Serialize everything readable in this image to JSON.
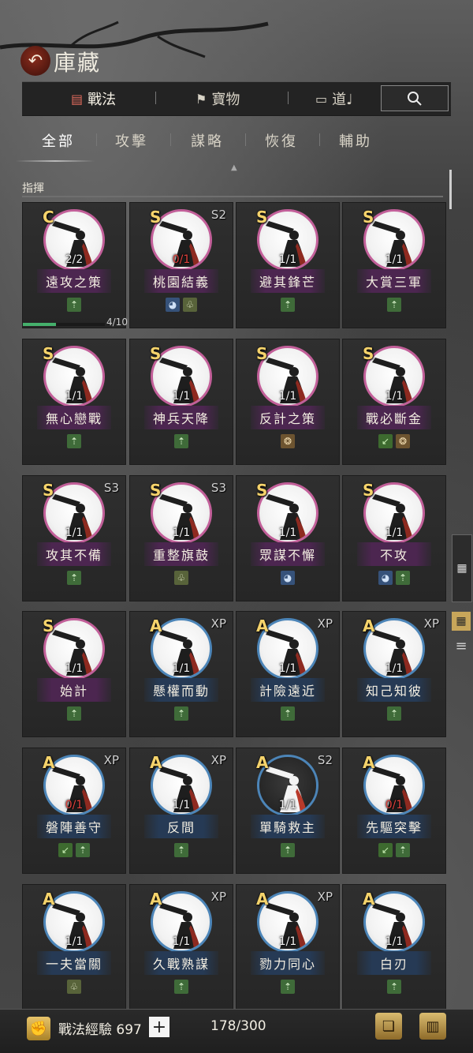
{
  "header": {
    "title": "庫藏",
    "back_icon": "arrow-left-icon"
  },
  "main_tabs": [
    {
      "label": "戰法",
      "icon": "scroll-icon",
      "active": true
    },
    {
      "label": "寶物",
      "icon": "flag-icon",
      "active": false
    },
    {
      "label": "道♩",
      "icon": "book-icon",
      "active": false
    }
  ],
  "search": {
    "icon": "search-icon"
  },
  "sub_tabs": [
    {
      "label": "全部",
      "active": true
    },
    {
      "label": "攻擊",
      "active": false
    },
    {
      "label": "謀略",
      "active": false
    },
    {
      "label": "恢復",
      "active": false
    },
    {
      "label": "輔助",
      "active": false
    }
  ],
  "section": {
    "title": "指揮"
  },
  "cards": [
    {
      "grade": "C",
      "badge": "",
      "count": "2/2",
      "count_red": false,
      "name": "遠攻之策",
      "ring": "pink",
      "tags": [
        "green"
      ],
      "progress": "4/10",
      "progress_value": 0.4
    },
    {
      "grade": "S",
      "badge": "S2",
      "count": "0/1",
      "count_red": true,
      "name": "桃園結義",
      "ring": "pink",
      "tags": [
        "blue",
        "olive"
      ],
      "dark": false
    },
    {
      "grade": "S",
      "badge": "",
      "count": "1/1",
      "count_red": false,
      "name": "避其鋒芒",
      "ring": "pink",
      "tags": [
        "green"
      ]
    },
    {
      "grade": "S",
      "badge": "",
      "count": "1/1",
      "count_red": false,
      "name": "大賞三軍",
      "ring": "pink",
      "tags": [
        "green"
      ]
    },
    {
      "grade": "S",
      "badge": "",
      "count": "1/1",
      "count_red": false,
      "name": "無心戀戰",
      "ring": "pink",
      "tags": [
        "green"
      ]
    },
    {
      "grade": "S",
      "badge": "",
      "count": "1/1",
      "count_red": false,
      "name": "神兵天降",
      "ring": "pink",
      "tags": [
        "green"
      ]
    },
    {
      "grade": "S",
      "badge": "",
      "count": "1/1",
      "count_red": false,
      "name": "反計之策",
      "ring": "pink",
      "tags": [
        "gold"
      ]
    },
    {
      "grade": "S",
      "badge": "",
      "count": "1/1",
      "count_red": false,
      "name": "戰必斷金",
      "ring": "pink",
      "tags": [
        "leaf",
        "gold"
      ]
    },
    {
      "grade": "S",
      "badge": "S3",
      "count": "1/1",
      "count_red": false,
      "name": "攻其不備",
      "ring": "pink",
      "tags": [
        "green"
      ]
    },
    {
      "grade": "S",
      "badge": "S3",
      "count": "1/1",
      "count_red": false,
      "name": "重整旗鼓",
      "ring": "pink",
      "tags": [
        "olive"
      ]
    },
    {
      "grade": "S",
      "badge": "",
      "count": "1/1",
      "count_red": false,
      "name": "眾謀不懈",
      "ring": "pink",
      "tags": [
        "blue"
      ]
    },
    {
      "grade": "S",
      "badge": "",
      "count": "1/1",
      "count_red": false,
      "name": "不攻",
      "ring": "pink",
      "tags": [
        "blue",
        "green"
      ]
    },
    {
      "grade": "S",
      "badge": "",
      "count": "1/1",
      "count_red": false,
      "name": "始計",
      "ring": "pink",
      "tags": [
        "green"
      ]
    },
    {
      "grade": "A",
      "badge": "XP",
      "count": "1/1",
      "count_red": false,
      "name": "懸權而動",
      "ring": "blue",
      "tags": [
        "green"
      ]
    },
    {
      "grade": "A",
      "badge": "XP",
      "count": "1/1",
      "count_red": false,
      "name": "計險遠近",
      "ring": "blue",
      "tags": [
        "green"
      ]
    },
    {
      "grade": "A",
      "badge": "XP",
      "count": "1/1",
      "count_red": false,
      "name": "知己知彼",
      "ring": "blue",
      "tags": [
        "green"
      ]
    },
    {
      "grade": "A",
      "badge": "XP",
      "count": "0/1",
      "count_red": true,
      "name": "磐陣善守",
      "ring": "blue",
      "tags": [
        "leaf",
        "green"
      ]
    },
    {
      "grade": "A",
      "badge": "XP",
      "count": "1/1",
      "count_red": false,
      "name": "反間",
      "ring": "blue",
      "tags": [
        "green"
      ]
    },
    {
      "grade": "A",
      "badge": "S2",
      "count": "1/1",
      "count_red": false,
      "name": "單騎救主",
      "ring": "blue",
      "tags": [
        "green"
      ],
      "dark": true
    },
    {
      "grade": "A",
      "badge": "",
      "count": "0/1",
      "count_red": true,
      "name": "先驅突擊",
      "ring": "blue",
      "tags": [
        "leaf",
        "green"
      ]
    },
    {
      "grade": "A",
      "badge": "",
      "count": "1/1",
      "count_red": false,
      "name": "一夫當關",
      "ring": "blue",
      "tags": [
        "olive"
      ]
    },
    {
      "grade": "A",
      "badge": "XP",
      "count": "1/1",
      "count_red": false,
      "name": "久戰熟謀",
      "ring": "blue",
      "tags": [
        "green"
      ]
    },
    {
      "grade": "A",
      "badge": "XP",
      "count": "1/1",
      "count_red": false,
      "name": "勠力同心",
      "ring": "blue",
      "tags": [
        "green"
      ]
    },
    {
      "grade": "A",
      "badge": "",
      "count": "1/1",
      "count_red": false,
      "name": "白刃",
      "ring": "blue",
      "tags": [
        "green"
      ]
    }
  ],
  "bottom": {
    "exp_label": "戰法經驗 697",
    "plus_label": "+",
    "capacity": "178/300",
    "exp_icon": "fist-icon",
    "right_icons": [
      "book-scroll-icon",
      "bamboo-scroll-icon"
    ]
  },
  "side": {
    "grid_icon": "grid-small-icon",
    "grid_large_icon": "grid-large-icon",
    "list_icon": "list-icon"
  }
}
